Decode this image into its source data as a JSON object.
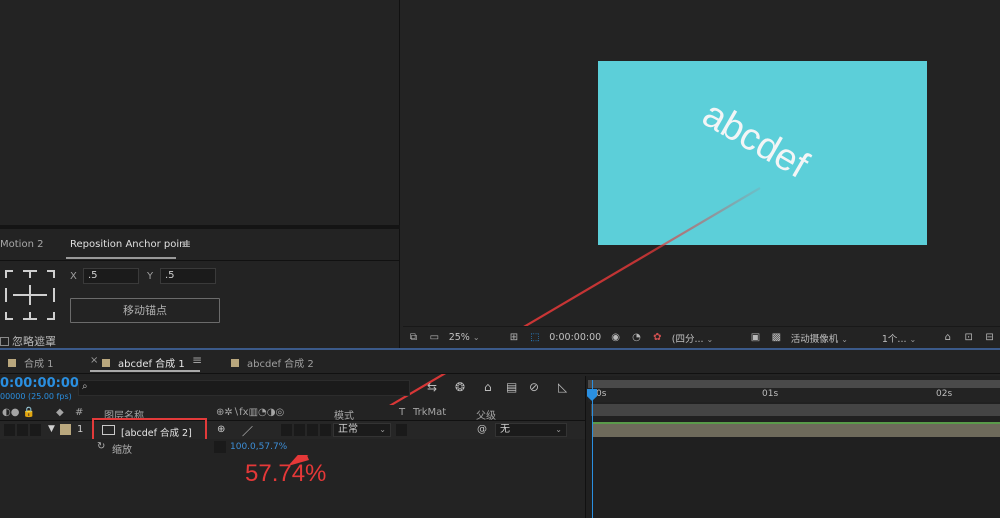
{
  "effect_panel": {
    "tab_left": "Motion 2",
    "tab_active": "Reposition Anchor point",
    "x_label": "X",
    "x_value": ".5",
    "y_label": "Y",
    "y_value": ".5",
    "move_anchor_button": "移动锚点",
    "ignore_mask_label": "忽略遮罩"
  },
  "viewer": {
    "comp_text": "abcdef",
    "canvas_color": "#5ccfd9",
    "zoom": "25%",
    "time": "0:00:00:00",
    "resolution": "(四分...",
    "camera": "活动摄像机",
    "views": "1个..."
  },
  "timeline": {
    "tabs": [
      "合成 1",
      "abcdef 合成 1",
      "abcdef 合成 2"
    ],
    "timecode": "0:00:00:00",
    "fps": "00000 (25.00 fps)",
    "headers": {
      "layer_name": "图层名称",
      "mode": "模式",
      "t": "T",
      "trkmat": "TrkMat",
      "parent": "父级"
    },
    "layer": {
      "index": "1",
      "name": "[abcdef 合成 2]",
      "mode": "正常",
      "parent": "无"
    },
    "property": {
      "name": "缩放",
      "value": "100.0,57.7%"
    },
    "ruler_labels": [
      "0s",
      "01s",
      "02s"
    ]
  },
  "annotation": "57.74%",
  "colors": {
    "accent_blue": "#2a8fe0",
    "highlight_red": "#e23a3a",
    "layer_label": "#b9a77d"
  }
}
